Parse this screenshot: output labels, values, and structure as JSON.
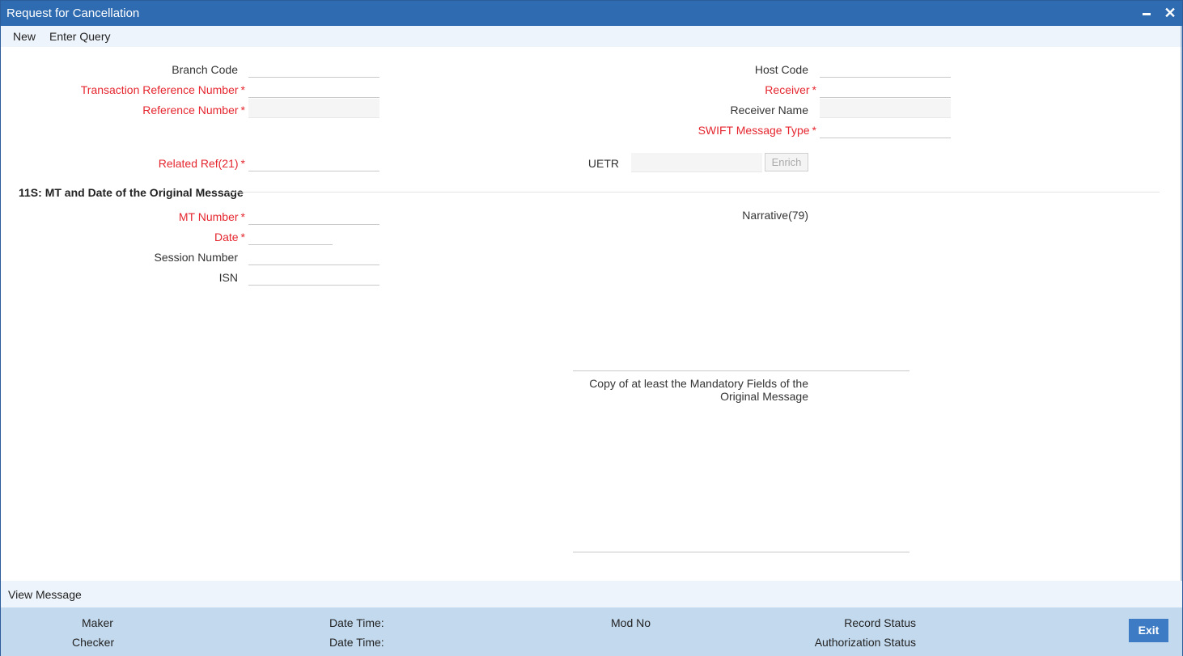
{
  "window": {
    "title": "Request for Cancellation"
  },
  "toolbar": {
    "new_label": "New",
    "enter_query_label": "Enter Query"
  },
  "form": {
    "branch_code": {
      "label": "Branch Code",
      "value": ""
    },
    "txn_ref": {
      "label": "Transaction Reference Number",
      "required": "*",
      "value": ""
    },
    "ref_number": {
      "label": "Reference Number",
      "required": "*",
      "value": ""
    },
    "related_ref": {
      "label": "Related Ref(21)",
      "required": "*",
      "value": ""
    },
    "host_code": {
      "label": "Host Code",
      "value": ""
    },
    "receiver": {
      "label": "Receiver",
      "required": "*",
      "value": ""
    },
    "receiver_name": {
      "label": "Receiver Name",
      "value": ""
    },
    "swift_msg_type": {
      "label": "SWIFT Message Type",
      "required": "*",
      "value": ""
    },
    "uetr": {
      "label": "UETR",
      "value": ""
    },
    "enrich_label": "Enrich"
  },
  "section": {
    "title": "11S: MT and Date of the Original Message",
    "mt_number": {
      "label": "MT Number",
      "required": "*",
      "value": ""
    },
    "date": {
      "label": "Date",
      "required": "*",
      "value": ""
    },
    "session_number": {
      "label": "Session Number",
      "value": ""
    },
    "isn": {
      "label": "ISN",
      "value": ""
    },
    "narrative": {
      "label": "Narrative(79)",
      "value": ""
    },
    "copy_fields": {
      "label_line1": "Copy of at least the Mandatory Fields of the",
      "label_line2": "Original Message",
      "value": ""
    }
  },
  "view_message_label": "View Message",
  "footer": {
    "maker_label": "Maker",
    "checker_label": "Checker",
    "date_time_label_1": "Date Time:",
    "date_time_label_2": "Date Time:",
    "mod_no_label": "Mod No",
    "record_status_label": "Record Status",
    "auth_status_label": "Authorization Status",
    "exit_label": "Exit"
  },
  "colors": {
    "titlebar": "#2f6bb0",
    "required": "#e5262f",
    "footer": "#c3d9ee",
    "exit_button": "#3d7cc4"
  }
}
